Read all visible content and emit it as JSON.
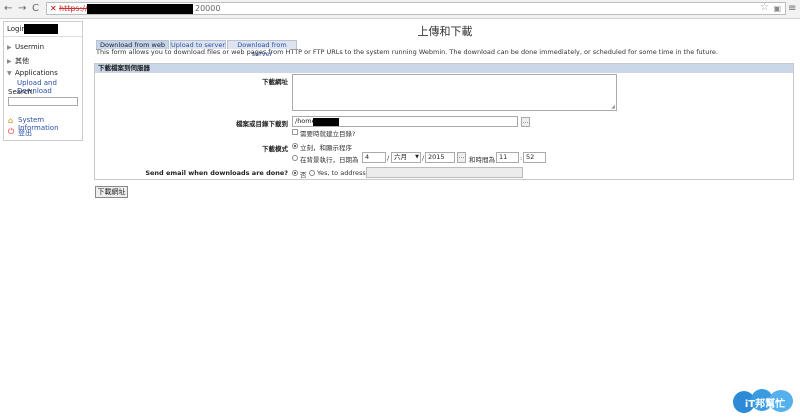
{
  "browser": {
    "back": "←",
    "forward": "→",
    "reload": "C",
    "url_protocol": "https://",
    "url_port": "20000",
    "star": "☆",
    "menu": "≡"
  },
  "sidebar": {
    "login_label": "Login:",
    "categories": [
      {
        "label": "Usermin"
      },
      {
        "label": "其他"
      },
      {
        "label": "Applications"
      }
    ],
    "upload_link": "Upload and Download",
    "search_label": "Search:",
    "system_info": "System Information",
    "logout": "登出"
  },
  "main": {
    "title": "上傳和下載",
    "tabs": [
      "Download from web",
      "Upload to server",
      "Download from server"
    ],
    "description": "This form allows you to download files or web pages from HTTP or FTP URLs to the system running Webmin. The download can be done immediately, or scheduled for some time in the future.",
    "panel_title": "下載檔案到伺服器",
    "fields": {
      "urls_label": "下載網址",
      "dest_label": "檔案或目錄下載到",
      "dest_value_prefix": "/home/",
      "browse": "...",
      "mkdir_label": "需要時就建立目錄?",
      "mode_label": "下載模式",
      "mode_now": "立刻，和顯示程序",
      "mode_sched": "在背景執行，日期為",
      "day": "4",
      "month": "六月",
      "year": "2015",
      "time_label": "和時間為",
      "hour": "11",
      "minute": "52",
      "email_label": "Send email when downloads are done?",
      "email_no": "否",
      "email_yes": "Yes, to address"
    },
    "submit": "下載網址"
  },
  "logo": {
    "text": "iT邦幫忙"
  }
}
